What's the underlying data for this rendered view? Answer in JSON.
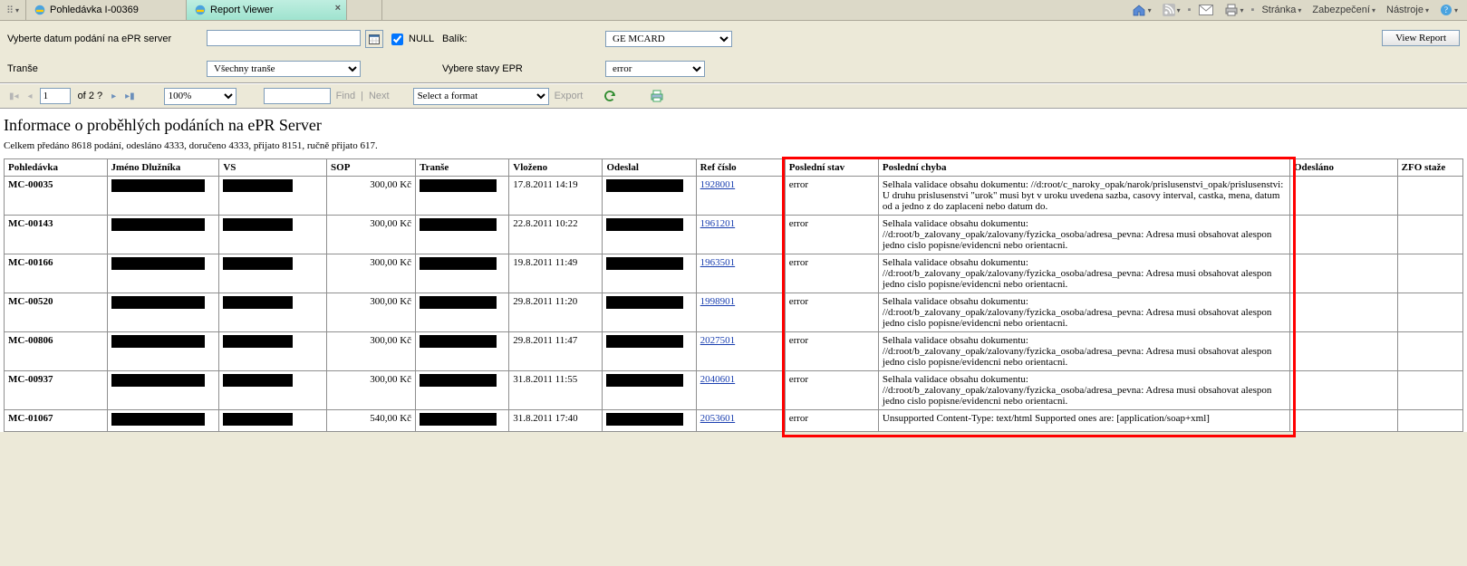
{
  "browser": {
    "tabs": [
      {
        "label": "Pohledávka I-00369",
        "active": false
      },
      {
        "label": "Report Viewer",
        "active": true
      }
    ],
    "tools": {
      "page_label": "Stránka",
      "security_label": "Zabezpečení",
      "tools_label": "Nástroje"
    }
  },
  "params": {
    "date_label": "Vyberte datum podání na ePR server",
    "date_value": "",
    "null_label": "NULL",
    "balik_label": "Balík:",
    "balik_value": "GE MCARD",
    "transe_label": "Tranše",
    "transe_value": "Všechny tranše",
    "stavy_label": "Vybere stavy EPR",
    "stavy_value": "error",
    "view_report": "View Report"
  },
  "toolbar": {
    "page": "1",
    "of_label": "of",
    "total": "2 ?",
    "zoom": "100%",
    "find_label": "Find",
    "next_label": "Next",
    "format_value": "Select a format",
    "export_label": "Export"
  },
  "report": {
    "title": "Informace o proběhlých podáních na ePR Server",
    "summary": "Celkem předáno 8618 podání, odesláno 4333, doručeno 4333, přijato 8151, ručně přijato 617.",
    "columns": [
      "Pohledávka",
      "Jméno Dlužníka",
      "VS",
      "SOP",
      "Tranše",
      "Vloženo",
      "Odeslal",
      "Ref číslo",
      "Poslední stav",
      "Poslední chyba",
      "Odesláno",
      "ZFO staže"
    ],
    "rows": [
      {
        "poh": "MC-00035",
        "sop": "300,00 Kč",
        "vlozeno": "17.8.2011 14:19",
        "ref": "1928001",
        "stav": "error",
        "chyba": "Selhala validace obsahu dokumentu: //d:root/c_naroky_opak/narok/prislusenstvi_opak/prislusenstvi: U druhu prislusenstvi \"urok\" musi byt v uroku uvedena sazba, casovy interval, castka, mena, datum od a jedno z do zaplaceni nebo datum do."
      },
      {
        "poh": "MC-00143",
        "sop": "300,00 Kč",
        "vlozeno": "22.8.2011 10:22",
        "ref": "1961201",
        "stav": "error",
        "chyba": "Selhala validace obsahu dokumentu: //d:root/b_zalovany_opak/zalovany/fyzicka_osoba/adresa_pevna: Adresa musi obsahovat alespon jedno cislo popisne/evidencni nebo orientacni."
      },
      {
        "poh": "MC-00166",
        "sop": "300,00 Kč",
        "vlozeno": "19.8.2011 11:49",
        "ref": "1963501",
        "stav": "error",
        "chyba": "Selhala validace obsahu dokumentu: //d:root/b_zalovany_opak/zalovany/fyzicka_osoba/adresa_pevna: Adresa musi obsahovat alespon jedno cislo popisne/evidencni nebo orientacni."
      },
      {
        "poh": "MC-00520",
        "sop": "300,00 Kč",
        "vlozeno": "29.8.2011 11:20",
        "ref": "1998901",
        "stav": "error",
        "chyba": "Selhala validace obsahu dokumentu: //d:root/b_zalovany_opak/zalovany/fyzicka_osoba/adresa_pevna: Adresa musi obsahovat alespon jedno cislo popisne/evidencni nebo orientacni."
      },
      {
        "poh": "MC-00806",
        "sop": "300,00 Kč",
        "vlozeno": "29.8.2011 11:47",
        "ref": "2027501",
        "stav": "error",
        "chyba": "Selhala validace obsahu dokumentu: //d:root/b_zalovany_opak/zalovany/fyzicka_osoba/adresa_pevna: Adresa musi obsahovat alespon jedno cislo popisne/evidencni nebo orientacni."
      },
      {
        "poh": "MC-00937",
        "sop": "300,00 Kč",
        "vlozeno": "31.8.2011 11:55",
        "ref": "2040601",
        "stav": "error",
        "chyba": "Selhala validace obsahu dokumentu: //d:root/b_zalovany_opak/zalovany/fyzicka_osoba/adresa_pevna: Adresa musi obsahovat alespon jedno cislo popisne/evidencni nebo orientacni."
      },
      {
        "poh": "MC-01067",
        "sop": "540,00 Kč",
        "vlozeno": "31.8.2011 17:40",
        "ref": "2053601",
        "stav": "error",
        "chyba": "Unsupported Content-Type: text/html Supported ones are: [application/soap+xml]"
      }
    ]
  }
}
